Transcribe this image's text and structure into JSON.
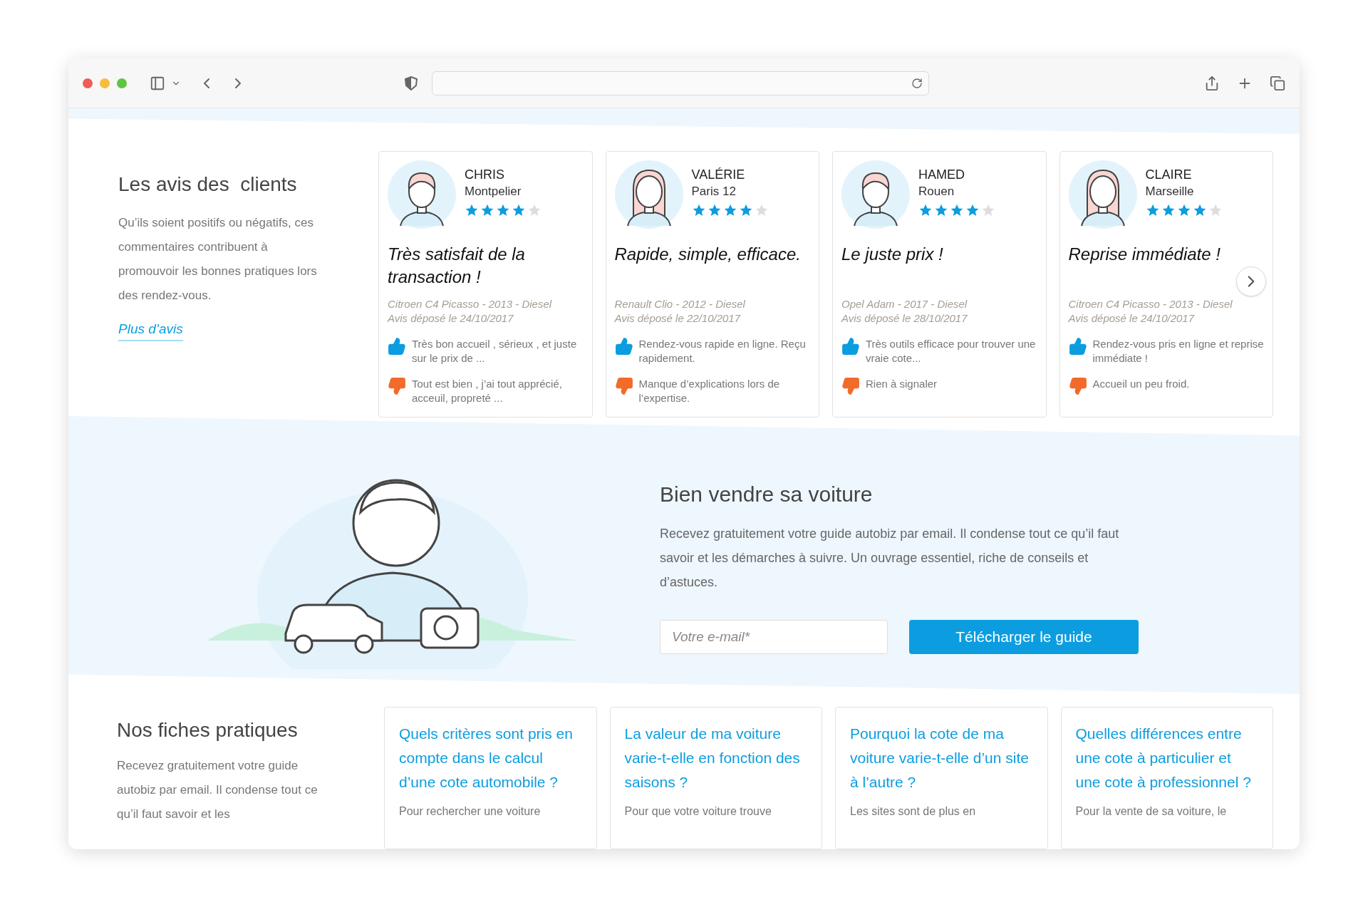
{
  "reviews": {
    "title": "Les avis des  clients",
    "description": "Qu’ils soient positifs ou négatifs, ces commentaires contribuent à promouvoir les bonnes pratiques lors des rendez-vous.",
    "more_link": "Plus d’avis",
    "items": [
      {
        "kind": "man",
        "name": "CHRIS",
        "city": "Montpelier",
        "stars": 4,
        "title": "Très satisfait de la transaction !",
        "vehicle": "Citroen C4 Picasso - 2013 - Diesel",
        "date": "Avis déposé le 24/10/2017",
        "pro": "Très bon accueil , sérieux , et juste sur le prix de ...",
        "con": "Tout est bien , j’ai tout apprécié, acceuil, propreté ..."
      },
      {
        "kind": "woman",
        "name": "VALÉRIE",
        "city": "Paris 12",
        "stars": 4,
        "title": "Rapide, simple, efficace.",
        "vehicle": "Renault Clio - 2012 - Diesel",
        "date": "Avis déposé le 22/10/2017",
        "pro": "Rendez-vous rapide en ligne. Reçu rapidement.",
        "con": "Manque d’explications lors de l’expertise."
      },
      {
        "kind": "man",
        "name": "HAMED",
        "city": "Rouen",
        "stars": 4,
        "title": "Le juste prix !",
        "vehicle": "Opel Adam - 2017 - Diesel",
        "date": "Avis déposé le 28/10/2017",
        "pro": "Très outils efficace pour trouver une vraie cote...",
        "con": "Rien à signaler"
      },
      {
        "kind": "woman",
        "name": "CLAIRE",
        "city": "Marseille",
        "stars": 4,
        "title": "Reprise immédiate !",
        "vehicle": "Citroen C4 Picasso - 2013 - Diesel",
        "date": "Avis déposé le 24/10/2017",
        "pro": "Rendez-vous pris en ligne et reprise immédiate !",
        "con": "Accueil un peu froid."
      }
    ]
  },
  "guide": {
    "title": "Bien vendre sa voiture",
    "description": "Recevez gratuitement votre guide autobiz par email. Il condense tout ce qu’il faut savoir et les démarches à suivre. Un ouvrage essentiel, riche de conseils et d’astuces.",
    "email": {
      "placeholder": "Votre e-mail*"
    },
    "button": "Télécharger le guide"
  },
  "fiches": {
    "title": "Nos fiches pratiques",
    "description": "Recevez gratuitement votre guide autobiz par email. Il condense tout ce qu’il faut savoir et les",
    "items": [
      {
        "title": "Quels critères sont pris en compte dans le calcul d’une cote automobile ?",
        "excerpt": "Pour rechercher une voiture"
      },
      {
        "title": "La valeur de ma voiture varie-t-elle en fonction des saisons ?",
        "excerpt": "Pour que votre voiture trouve"
      },
      {
        "title": "Pourquoi la cote de ma voiture varie-t-elle d’un site à l’autre ?",
        "excerpt": "Les sites sont de plus en"
      },
      {
        "title": "Quelles différences entre une cote à particulier et une cote à professionnel ?",
        "excerpt": "Pour la vente de sa voiture, le"
      }
    ]
  }
}
